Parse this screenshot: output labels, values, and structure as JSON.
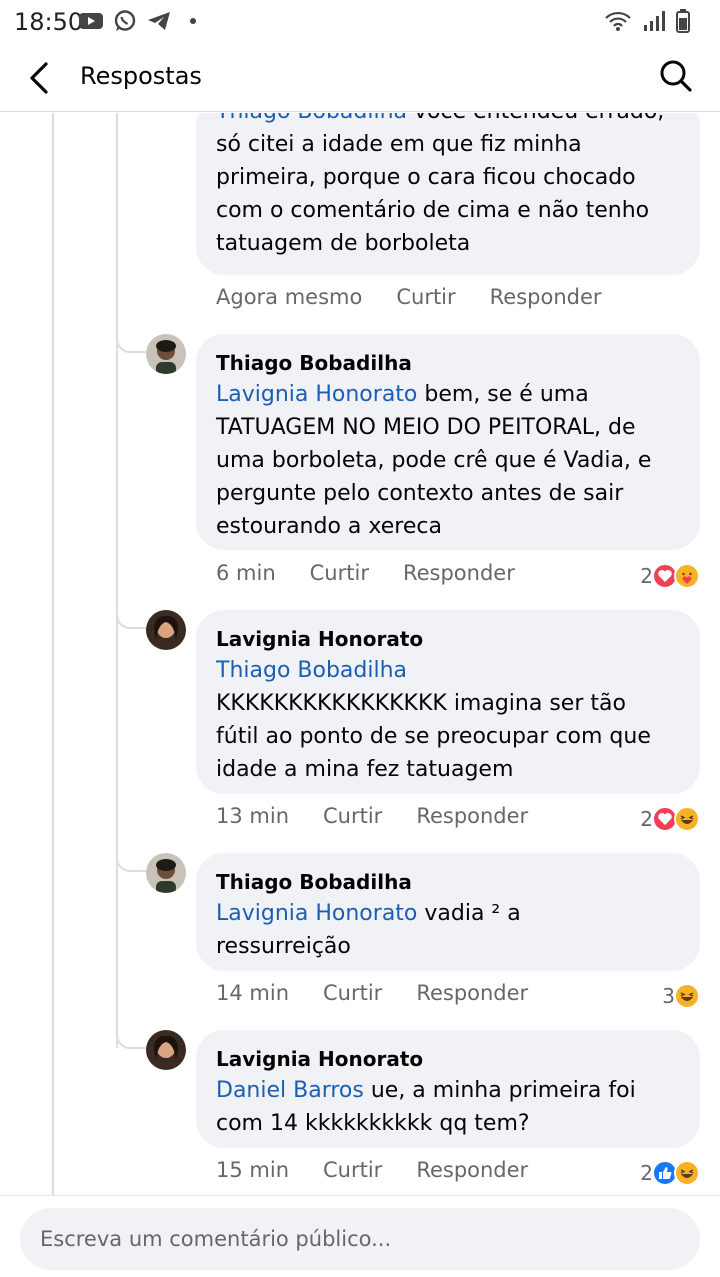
{
  "status_bar": {
    "time": "18:50"
  },
  "header": {
    "title": "Respostas"
  },
  "comments": [
    {
      "lines": [
        "Thiago Bobadilha você entendeu errado,",
        "só citei a idade em que fiz minha",
        "primeira, porque o cara ficou chocado",
        "com o comentário de cima e não tenho",
        "tatuagem de borboleta"
      ],
      "mention": "Thiago Bobadilha",
      "first_line_rest": " você entendeu errado,",
      "line2": "só citei a idade em que fiz minha",
      "line3": "primeira, porque o cara ficou chocado",
      "line4": "com o comentário de cima e não tenho",
      "line5": "tatuagem de borboleta",
      "time": "Agora mesmo",
      "like": "Curtir",
      "reply": "Responder"
    },
    {
      "author": "Thiago Bobadilha",
      "mention": "Lavignia Honorato",
      "first_line_rest": " bem, se é uma",
      "line2": "TATUAGEM NO MEIO DO PEITORAL, de",
      "line3": "uma borboleta, pode crê que é Vadia, e",
      "line4": "pergunte pelo contexto antes de sair",
      "line5": "estourando a xereca",
      "time": "6 min",
      "like": "Curtir",
      "reply": "Responder",
      "reaction_count": "2"
    },
    {
      "author": "Lavignia Honorato",
      "mention": "Thiago Bobadilha",
      "line2": "KKKKKKKKKKKKKKKK imagina ser tão",
      "line3": "fútil ao ponto de se preocupar com que",
      "line4": "idade a mina fez tatuagem",
      "time": "13 min",
      "like": "Curtir",
      "reply": "Responder",
      "reaction_count": "2"
    },
    {
      "author": "Thiago Bobadilha",
      "mention": "Lavignia Honorato",
      "first_line_rest": " vadia ² a",
      "line2": "ressurreição",
      "time": "14 min",
      "like": "Curtir",
      "reply": "Responder",
      "reaction_count": "3"
    },
    {
      "author": "Lavignia Honorato",
      "mention": "Daniel Barros",
      "first_line_rest": " ue, a minha primeira foi",
      "line2": "com 14 kkkkkkkkkk qq tem?",
      "time": "15 min",
      "like": "Curtir",
      "reply": "Responder",
      "reaction_count": "2"
    }
  ],
  "composer": {
    "placeholder": "Escreva um comentário público..."
  },
  "colors": {
    "mention": "#1b5fb4",
    "bubble": "#f0f2f5",
    "love": "#f33e58",
    "like": "#1877f2",
    "haha": "#f7b125"
  }
}
